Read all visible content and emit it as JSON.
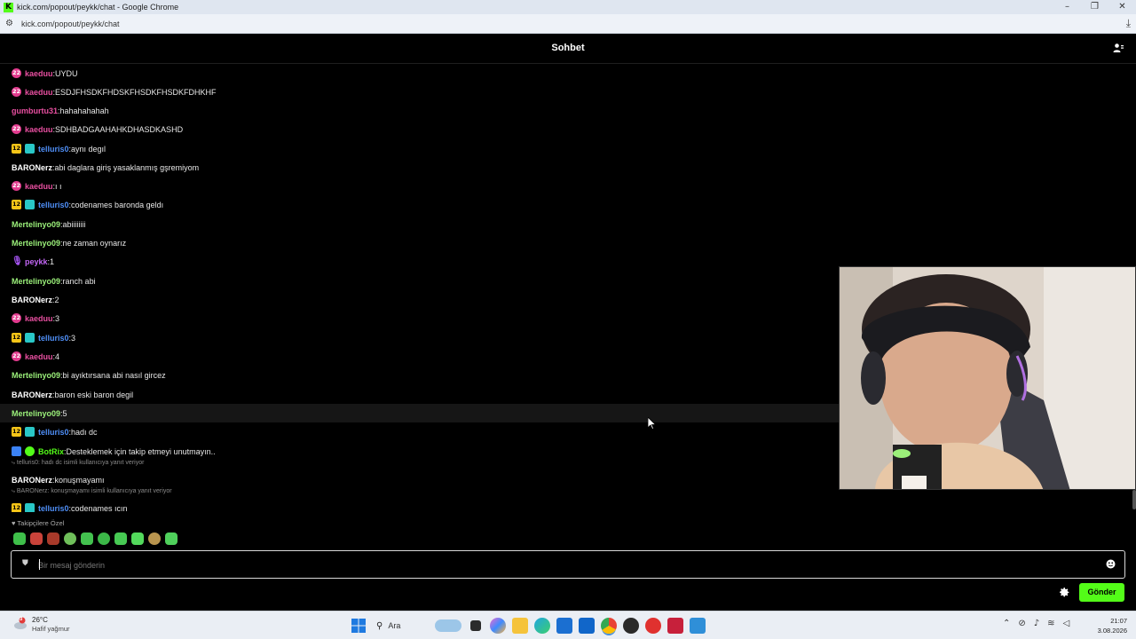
{
  "browser": {
    "window_title": "kick.com/popout/peykk/chat - Google Chrome",
    "url": "kick.com/popout/peykk/chat",
    "favicon_letter": "K"
  },
  "chat": {
    "title": "Sohbet",
    "messages": [
      {
        "user": "kaeduu",
        "color": "#e84fa0",
        "badges": [
          "22"
        ],
        "text": "UYDU"
      },
      {
        "user": "kaeduu",
        "color": "#e84fa0",
        "badges": [
          "22"
        ],
        "text": "ESDJFHSDKFHDSKFHSDKFHSDKFDHKHF"
      },
      {
        "user": "gumburtu31",
        "color": "#e84fa0",
        "badges": [],
        "text": "hahahahahah"
      },
      {
        "user": "kaeduu",
        "color": "#e84fa0",
        "badges": [
          "22"
        ],
        "text": "SDHBADGAAHAHKDHASDKASHD"
      },
      {
        "user": "telluris0",
        "color": "#4f8ff7",
        "badges": [
          "12",
          "sub"
        ],
        "text": "aynı degıl"
      },
      {
        "user": "BARONerz",
        "color": "#ffffff",
        "badges": [],
        "text": "abi daglara giriş yasaklanmış gşremiyom"
      },
      {
        "user": "kaeduu",
        "color": "#e84fa0",
        "badges": [
          "22"
        ],
        "text": "ı ı"
      },
      {
        "user": "telluris0",
        "color": "#4f8ff7",
        "badges": [
          "12",
          "sub"
        ],
        "text": "codenames baronda geldı"
      },
      {
        "user": "Mertelinyo09",
        "color": "#9bf07a",
        "badges": [],
        "text": "abiiiiiiii"
      },
      {
        "user": "Mertelinyo09",
        "color": "#9bf07a",
        "badges": [],
        "text": "ne zaman oynarız"
      },
      {
        "user": "peykk",
        "color": "#c266f5",
        "badges": [
          "mic"
        ],
        "text": "1"
      },
      {
        "user": "Mertelinyo09",
        "color": "#9bf07a",
        "badges": [],
        "text": "ranch abi"
      },
      {
        "user": "BARONerz",
        "color": "#ffffff",
        "badges": [],
        "text": "2"
      },
      {
        "user": "kaeduu",
        "color": "#e84fa0",
        "badges": [
          "22"
        ],
        "text": "3"
      },
      {
        "user": "telluris0",
        "color": "#4f8ff7",
        "badges": [
          "12",
          "sub"
        ],
        "text": "3"
      },
      {
        "user": "kaeduu",
        "color": "#e84fa0",
        "badges": [
          "22"
        ],
        "text": "4"
      },
      {
        "user": "Mertelinyo09",
        "color": "#9bf07a",
        "badges": [],
        "text": "bi ayıktırsana abi nasıl gircez"
      },
      {
        "user": "BARONerz",
        "color": "#ffffff",
        "badges": [],
        "text": "baron eski baron degil"
      },
      {
        "user": "Mertelinyo09",
        "color": "#9bf07a",
        "badges": [],
        "text": "5"
      },
      {
        "user": "telluris0",
        "color": "#4f8ff7",
        "badges": [
          "12",
          "sub"
        ],
        "text": "hadı dc"
      },
      {
        "user": "BotRix",
        "color": "#53fc18",
        "badges": [
          "bot1",
          "bot2"
        ],
        "text": "Desteklemek için takip etmeyi unutmayın.."
      },
      {
        "user": "BARONerz",
        "color": "#ffffff",
        "badges": [],
        "text": "konuşmayamı"
      },
      {
        "user": "telluris0",
        "color": "#4f8ff7",
        "badges": [
          "12",
          "sub"
        ],
        "text": "codenames ıcın"
      }
    ],
    "replies": [
      {
        "text": "telluris0: hadı dc isimli kullanıcıya yanıt veriyor"
      },
      {
        "text": "BARONerz: konuşmayamı isimli kullanıcıya yanıt veriyor"
      }
    ],
    "followers_label": "Takipçilere Özel",
    "input_placeholder": "Bir mesaj gönderin",
    "send_label": "Gönder"
  },
  "taskbar": {
    "temperature": "26°C",
    "weather": "Hafif yağmur",
    "weather_badge": "3",
    "search_label": "Ara",
    "time": "21:07",
    "date": "3.08.2026"
  },
  "colors": {
    "accent": "#53fc18",
    "background": "#000000"
  }
}
